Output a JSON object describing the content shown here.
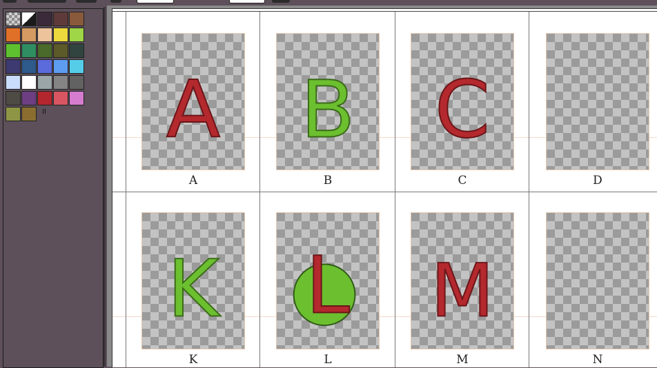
{
  "palette": {
    "colors": [
      "#9a9a9a",
      "#ffffff",
      "#3b2a3a",
      "#5e3b3a",
      "#8a5a3c",
      "#e06f27",
      "#d49a62",
      "#edc39c",
      "#ecd93d",
      "#9ed648",
      "#5ec02f",
      "#2f8f62",
      "#4a6a2b",
      "#5c5a28",
      "#314440",
      "#3d3a72",
      "#2e5a8c",
      "#5b6bdc",
      "#5e9cf0",
      "#56cde8",
      "#c9dcfb",
      "#ffffff",
      "#9aa6a8",
      "#848484",
      "#626262",
      "#4e4a44",
      "#6e3e82",
      "#b4262e",
      "#d85562",
      "#d67ccf",
      "#8e9646",
      "#8a6e30"
    ],
    "page_indicator": "II"
  },
  "cards": [
    {
      "id": "A",
      "label": "A",
      "glyph": "A",
      "glyph_color": "#b3292e",
      "shape": null
    },
    {
      "id": "B",
      "label": "B",
      "glyph": "B",
      "glyph_color": "#6cbf2f",
      "shape": null
    },
    {
      "id": "C",
      "label": "C",
      "glyph": "C",
      "glyph_color": "#b3292e",
      "shape": null
    },
    {
      "id": "D",
      "label": "D",
      "glyph": "",
      "glyph_color": "",
      "shape": null
    },
    {
      "id": "K",
      "label": "K",
      "glyph": "K",
      "glyph_color": "#6cbf2f",
      "shape": null
    },
    {
      "id": "L",
      "label": "L",
      "glyph": "L",
      "glyph_color": "#b3292e",
      "shape": "circle",
      "shape_color": "#6cbf2f"
    },
    {
      "id": "M",
      "label": "M",
      "glyph": "M",
      "glyph_color": "#b3292e",
      "shape": null
    },
    {
      "id": "N",
      "label": "N",
      "glyph": "",
      "glyph_color": "",
      "shape": null
    }
  ]
}
